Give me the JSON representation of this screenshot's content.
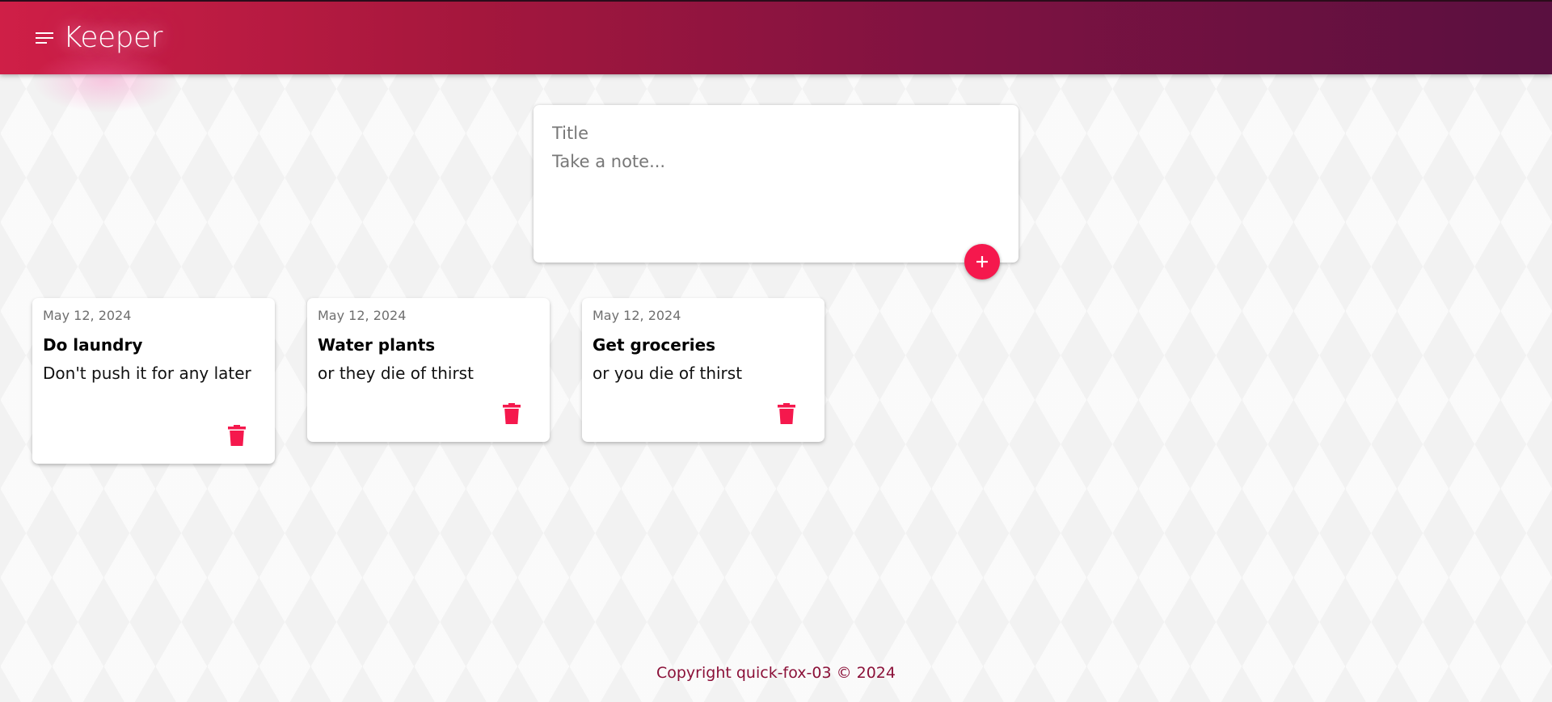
{
  "header": {
    "app_title": "Keeper"
  },
  "create_note": {
    "title_placeholder": "Title",
    "content_placeholder": "Take a note..."
  },
  "notes": [
    {
      "date": "May 12, 2024",
      "title": "Do laundry",
      "content": "Don't push it for any later"
    },
    {
      "date": "May 12, 2024",
      "title": "Water plants",
      "content": "or they die of thirst"
    },
    {
      "date": "May 12, 2024",
      "title": "Get groceries",
      "content": "or you die of thirst"
    }
  ],
  "footer": {
    "copyright": "Copyright quick-fox-03 © 2024"
  },
  "colors": {
    "accent": "#f5184d",
    "header_start": "#cf1f47",
    "header_end": "#5a1040",
    "footer_text": "#8b1038"
  },
  "icons": {
    "menu": "menu-icon",
    "add": "plus-icon",
    "delete": "trash-icon"
  }
}
